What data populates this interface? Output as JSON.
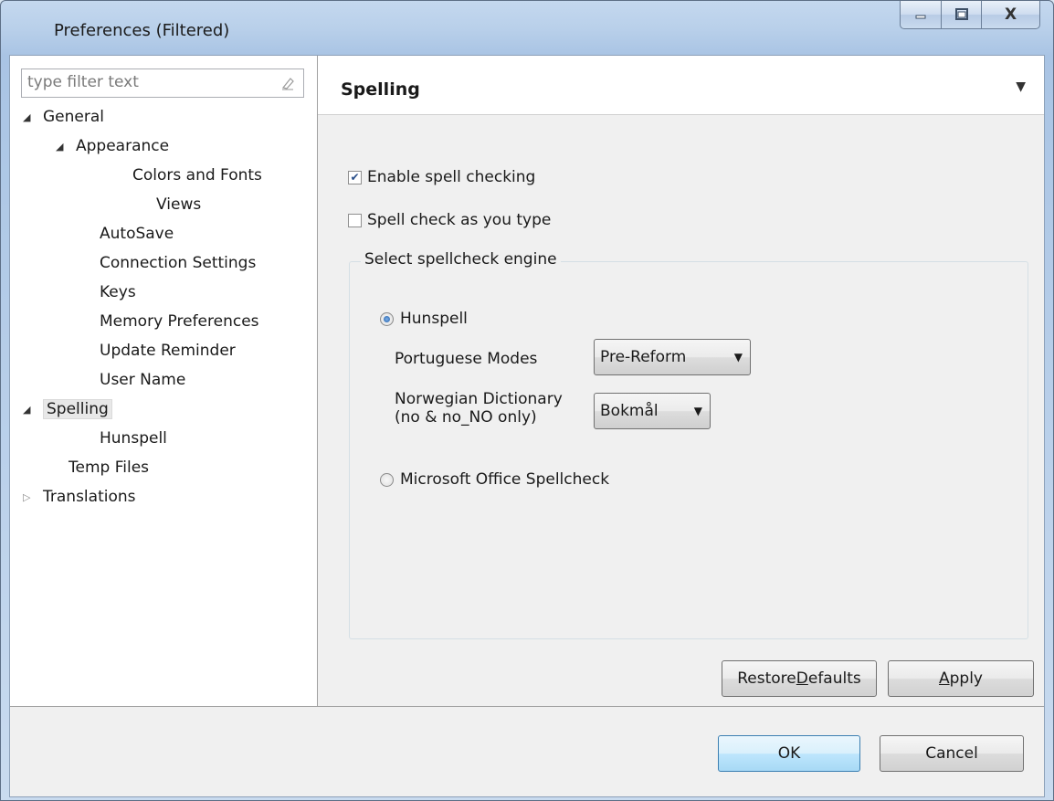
{
  "window": {
    "title": "Preferences (Filtered)",
    "min_icon": "minimize-icon",
    "max_icon": "maximize-icon",
    "close_label": "X"
  },
  "filter": {
    "placeholder": "type filter text"
  },
  "tree": [
    {
      "label": "General",
      "arrow": "expanded"
    },
    {
      "label": "Appearance",
      "arrow": "expanded"
    },
    {
      "label": "Colors and Fonts",
      "arrow": "none"
    },
    {
      "label": "Views",
      "arrow": "none"
    },
    {
      "label": "AutoSave",
      "arrow": "none"
    },
    {
      "label": "Connection Settings",
      "arrow": "none"
    },
    {
      "label": "Keys",
      "arrow": "none"
    },
    {
      "label": "Memory Preferences",
      "arrow": "none"
    },
    {
      "label": "Update Reminder",
      "arrow": "none"
    },
    {
      "label": "User Name",
      "arrow": "none"
    },
    {
      "label": "Spelling",
      "arrow": "expanded",
      "selected": true
    },
    {
      "label": "Hunspell",
      "arrow": "none"
    },
    {
      "label": "Temp Files",
      "arrow": "none"
    },
    {
      "label": "Translations",
      "arrow": "collapsed"
    }
  ],
  "page": {
    "title": "Spelling",
    "enable_spell": {
      "label": "Enable spell checking",
      "checked": true
    },
    "spell_as_type": {
      "label": "Spell check as you type",
      "checked": false
    },
    "engine_group": {
      "legend": "Select spellcheck engine",
      "hunspell": {
        "label": "Hunspell",
        "selected": true
      },
      "portuguese": {
        "label": "Portuguese Modes",
        "value": "Pre-Reform"
      },
      "norwegian": {
        "label_line1": "Norwegian Dictionary",
        "label_line2": "(no & no_NO only)",
        "value": "Bokmål"
      },
      "ms_office": {
        "label": "Microsoft Office Spellcheck",
        "selected": false
      }
    },
    "restore_defaults": {
      "prefix": "Restore ",
      "mnemonic": "D",
      "suffix": "efaults"
    },
    "apply": {
      "mnemonic": "A",
      "suffix": "pply"
    }
  },
  "dialog": {
    "ok": "OK",
    "cancel": "Cancel"
  }
}
